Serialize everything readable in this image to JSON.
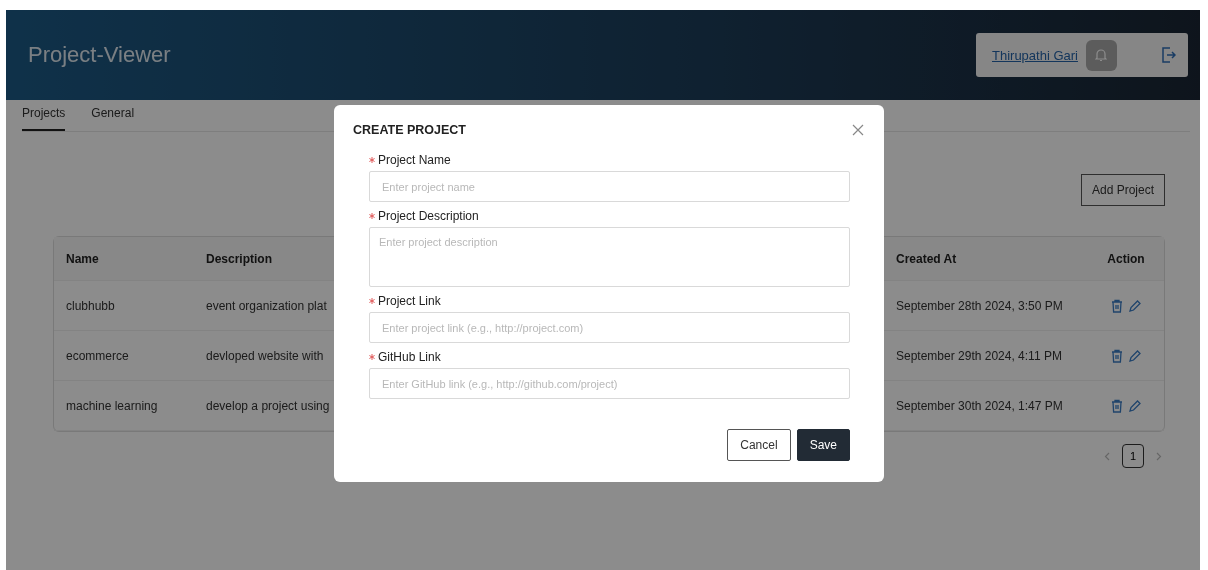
{
  "header": {
    "title": "Project-Viewer",
    "user": "Thirupathi Gari"
  },
  "tabs": [
    {
      "label": "Projects",
      "selected": true
    },
    {
      "label": "General",
      "selected": false
    }
  ],
  "add_button": "Add Project",
  "table": {
    "columns": [
      "Name",
      "Description",
      "Created At",
      "Action"
    ],
    "rows": [
      {
        "name": "clubhubb",
        "description": "event organization plat",
        "created_at": "September 28th 2024, 3:50 PM"
      },
      {
        "name": "ecommerce",
        "description": "devloped website with",
        "created_at": "September 29th 2024, 4:11 PM"
      },
      {
        "name": "machine learning",
        "description": "develop a project using",
        "created_at": "September 30th 2024, 1:47 PM"
      }
    ]
  },
  "pagination": {
    "prev_disabled": true,
    "next_disabled": true,
    "pages": [
      {
        "label": "1",
        "selected": true
      }
    ]
  },
  "dialog": {
    "title": "CREATE PROJECT",
    "fields": [
      {
        "kind": "input",
        "label": "Project Name",
        "required": true,
        "placeholder": "Enter project name"
      },
      {
        "kind": "textarea",
        "label": "Project Description",
        "required": true,
        "placeholder": "Enter project description"
      },
      {
        "kind": "input",
        "label": "Project Link",
        "required": true,
        "placeholder": "Enter project link (e.g., http://project.com)"
      },
      {
        "kind": "input",
        "label": "GitHub Link",
        "required": true,
        "placeholder": "Enter GitHub link (e.g., http://github.com/project)"
      }
    ],
    "buttons": [
      {
        "label": "Cancel",
        "kind": "secondary"
      },
      {
        "label": "Save",
        "kind": "primary"
      }
    ]
  }
}
